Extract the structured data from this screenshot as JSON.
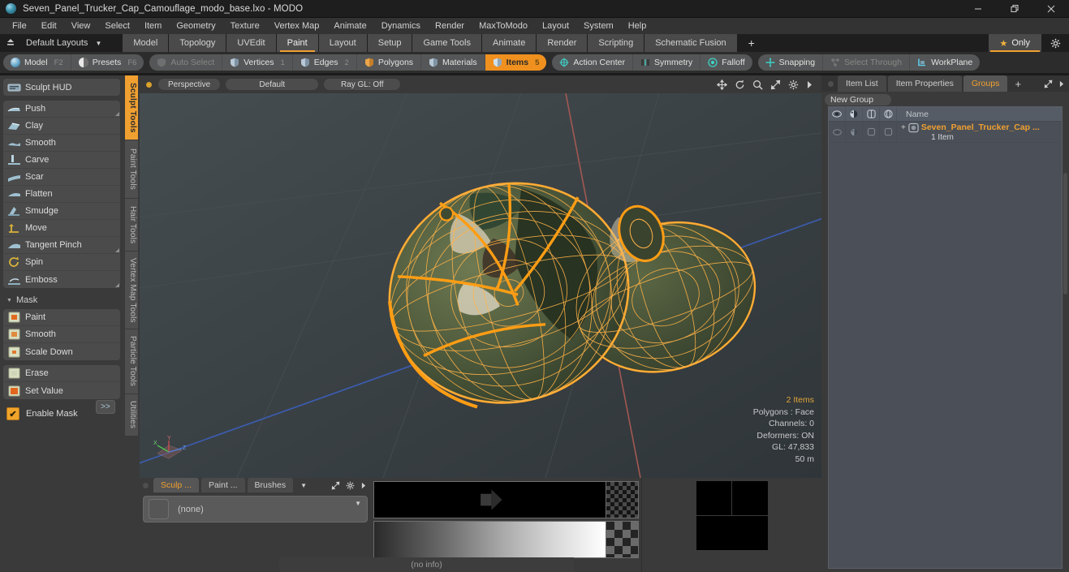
{
  "window": {
    "title": "Seven_Panel_Trucker_Cap_Camouflage_modo_base.lxo - MODO",
    "app_icon": "modo-orb-icon",
    "controls": {
      "minimize": "minimize-icon",
      "restore": "restore-icon",
      "close": "close-icon"
    }
  },
  "menubar": {
    "items": [
      "File",
      "Edit",
      "View",
      "Select",
      "Item",
      "Geometry",
      "Texture",
      "Vertex Map",
      "Animate",
      "Dynamics",
      "Render",
      "MaxToModo",
      "Layout",
      "System",
      "Help"
    ]
  },
  "layoutbar": {
    "up_icon": "upload-icon",
    "layout_label": "Default Layouts",
    "caret": "▼",
    "tabs": [
      {
        "label": "Model",
        "selected": false
      },
      {
        "label": "Topology",
        "selected": false
      },
      {
        "label": "UVEdit",
        "selected": false
      },
      {
        "label": "Paint",
        "selected": true
      },
      {
        "label": "Layout",
        "selected": false
      },
      {
        "label": "Setup",
        "selected": false
      },
      {
        "label": "Game Tools",
        "selected": false
      },
      {
        "label": "Animate",
        "selected": false
      },
      {
        "label": "Render",
        "selected": false
      },
      {
        "label": "Scripting",
        "selected": false
      },
      {
        "label": "Schematic Fusion",
        "selected": false
      }
    ],
    "add_label": "+",
    "only_label": "Only",
    "star_icon": "star-icon",
    "gear_icon": "gear-icon"
  },
  "modebar": {
    "group1": [
      {
        "label": "Model",
        "key": "F2",
        "icon": "sphere-blue-icon",
        "state": "normal"
      },
      {
        "label": "Presets",
        "key": "F6",
        "icon": "sphere-half-icon",
        "state": "normal"
      }
    ],
    "group2": [
      {
        "label": "Auto Select",
        "key": "",
        "icon": "shield-icon",
        "state": "dim"
      },
      {
        "label": "Vertices",
        "key": "1",
        "icon": "shield-icon",
        "state": "normal"
      },
      {
        "label": "Edges",
        "key": "2",
        "icon": "shield-icon",
        "state": "normal"
      },
      {
        "label": "Polygons",
        "key": "",
        "icon": "shield-icon",
        "state": "normal"
      },
      {
        "label": "Materials",
        "key": "",
        "icon": "shield-icon",
        "state": "normal"
      },
      {
        "label": "Items",
        "key": "5",
        "icon": "shield-icon",
        "state": "on"
      }
    ],
    "group3": [
      {
        "label": "Action Center",
        "key": "",
        "icon": "target-icon",
        "state": "normal"
      },
      {
        "label": "Symmetry",
        "key": "",
        "icon": "symmetry-icon",
        "state": "normal"
      },
      {
        "label": "Falloff",
        "key": "",
        "icon": "falloff-icon",
        "state": "normal"
      }
    ],
    "group4": [
      {
        "label": "Snapping",
        "key": "",
        "icon": "snapping-icon",
        "state": "normal"
      },
      {
        "label": "Select Through",
        "key": "",
        "icon": "select-through-icon",
        "state": "dim"
      },
      {
        "label": "WorkPlane",
        "key": "",
        "icon": "workplane-icon",
        "state": "normal"
      }
    ]
  },
  "left_panel": {
    "hud": {
      "label": "Sculpt HUD",
      "icon": "hud-icon"
    },
    "sculpt_tools": [
      {
        "label": "Push",
        "icon": "push-icon",
        "corner": true
      },
      {
        "label": "Clay",
        "icon": "clay-icon",
        "corner": false
      },
      {
        "label": "Smooth",
        "icon": "smooth-icon",
        "corner": false
      },
      {
        "label": "Carve",
        "icon": "carve-icon",
        "corner": false
      },
      {
        "label": "Scar",
        "icon": "scar-icon",
        "corner": false
      },
      {
        "label": "Flatten",
        "icon": "flatten-icon",
        "corner": false
      },
      {
        "label": "Smudge",
        "icon": "smudge-icon",
        "corner": false
      },
      {
        "label": "Move",
        "icon": "move-icon",
        "corner": false
      },
      {
        "label": "Tangent Pinch",
        "icon": "tangent-pinch-icon",
        "corner": true
      },
      {
        "label": "Spin",
        "icon": "spin-icon",
        "corner": false
      },
      {
        "label": "Emboss",
        "icon": "emboss-icon",
        "corner": true
      }
    ],
    "mask_section": {
      "title": "Mask",
      "triangle": "▼",
      "group_a": [
        {
          "label": "Paint",
          "icon": "mask-paint-icon"
        },
        {
          "label": "Smooth",
          "icon": "mask-smooth-icon"
        },
        {
          "label": "Scale Down",
          "icon": "mask-scale-down-icon"
        }
      ],
      "group_b": [
        {
          "label": "Erase",
          "icon": "mask-erase-icon"
        },
        {
          "label": "Set Value",
          "icon": "mask-set-value-icon"
        }
      ],
      "enable_mask": {
        "label": "Enable Mask",
        "checked": true,
        "check": "✔"
      },
      "forward_label": ">>"
    },
    "vertical_tabs": [
      {
        "label": "Sculpt Tools",
        "selected": true
      },
      {
        "label": "Paint Tools",
        "selected": false
      },
      {
        "label": "Hair Tools",
        "selected": false
      },
      {
        "label": "Vertex Map Tools",
        "selected": false
      },
      {
        "label": "Particle Tools",
        "selected": false
      },
      {
        "label": "Utilities",
        "selected": false
      }
    ]
  },
  "viewport": {
    "header": {
      "dot": "view-dot",
      "buttons": [
        "Perspective",
        "Default",
        "Ray GL: Off"
      ],
      "icons": [
        "pan-icon",
        "rotate-icon",
        "zoom-icon",
        "fit-icon",
        "gear-icon",
        "arrow-right-icon"
      ]
    },
    "info": {
      "items_count": "2 Items",
      "polygons": "Polygons : Face",
      "channels": "Channels: 0",
      "deformers": "Deformers: ON",
      "gl": "GL: 47,833",
      "scale": "50 m"
    },
    "axis_gizmo": {
      "x": "X",
      "y": "Y",
      "z": "Z"
    },
    "colors": {
      "wireframe": "#ffa629",
      "surface": "#4a5a3d",
      "background": "#3b4246",
      "axis_x": "#b5504a",
      "axis_z": "#4a5ab5"
    }
  },
  "bottom_panel": {
    "tabs": [
      {
        "label": "Sculp ...",
        "selected": true
      },
      {
        "label": "Paint ...",
        "selected": false
      },
      {
        "label": "Brushes",
        "selected": false
      }
    ],
    "caret": "▼",
    "icons": [
      "expand-icon",
      "gear-icon",
      "arrow-right-icon"
    ],
    "brush_value": "(none)",
    "brush_caret": "▼",
    "status": "(no info)"
  },
  "right_panel": {
    "tabs": [
      {
        "label": "Item List",
        "selected": false
      },
      {
        "label": "Item Properties",
        "selected": false
      },
      {
        "label": "Groups",
        "selected": true
      }
    ],
    "add_label": "+",
    "icons": [
      "expand-icon",
      "arrow-right-icon"
    ],
    "new_group_label": "New Group",
    "columns": [
      "eye-icon",
      "render-icon",
      "shade-icon",
      "wireframe-icon",
      "Name"
    ],
    "rows": [
      {
        "name": "Seven_Panel_Trucker_Cap ...",
        "sub": "1 Item",
        "expand": "+",
        "icon": "group-icon"
      }
    ]
  }
}
